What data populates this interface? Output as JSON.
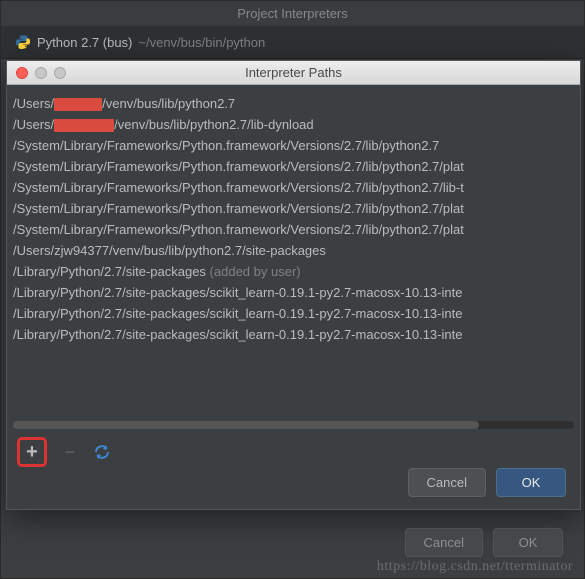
{
  "outer": {
    "title": "Project Interpreters",
    "interpreter_name": "Python 2.7 (bus)",
    "interpreter_path": "~/venv/bus/bin/python",
    "cancel_label": "Cancel",
    "ok_label": "OK"
  },
  "dialog": {
    "title": "Interpreter Paths",
    "paths": [
      {
        "prefix": "/Users/",
        "redacted": "xxxxxxxx",
        "suffix": "/venv/bus/lib/python2.7"
      },
      {
        "prefix": "/Users/",
        "redacted": "xxxxxxxxxx",
        "suffix": "/venv/bus/lib/python2.7/lib-dynload"
      },
      {
        "text": "/System/Library/Frameworks/Python.framework/Versions/2.7/lib/python2.7"
      },
      {
        "text": "/System/Library/Frameworks/Python.framework/Versions/2.7/lib/python2.7/plat"
      },
      {
        "text": "/System/Library/Frameworks/Python.framework/Versions/2.7/lib/python2.7/lib-t"
      },
      {
        "text": "/System/Library/Frameworks/Python.framework/Versions/2.7/lib/python2.7/plat"
      },
      {
        "text": "/System/Library/Frameworks/Python.framework/Versions/2.7/lib/python2.7/plat"
      },
      {
        "text": "/Users/zjw94377/venv/bus/lib/python2.7/site-packages"
      },
      {
        "text": "/Library/Python/2.7/site-packages",
        "hint": "  (added by user)"
      },
      {
        "text": "/Library/Python/2.7/site-packages/scikit_learn-0.19.1-py2.7-macosx-10.13-inte"
      },
      {
        "text": "/Library/Python/2.7/site-packages/scikit_learn-0.19.1-py2.7-macosx-10.13-inte"
      },
      {
        "text": "/Library/Python/2.7/site-packages/scikit_learn-0.19.1-py2.7-macosx-10.13-inte"
      }
    ],
    "add_label": "+",
    "remove_label": "−",
    "cancel_label": "Cancel",
    "ok_label": "OK"
  },
  "watermark": "https://blog.csdn.net/tterminator"
}
